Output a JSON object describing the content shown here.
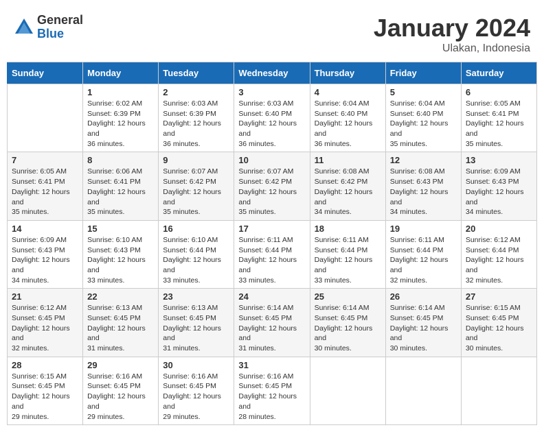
{
  "header": {
    "logo_general": "General",
    "logo_blue": "Blue",
    "month_year": "January 2024",
    "location": "Ulakan, Indonesia"
  },
  "columns": [
    "Sunday",
    "Monday",
    "Tuesday",
    "Wednesday",
    "Thursday",
    "Friday",
    "Saturday"
  ],
  "weeks": [
    [
      {
        "day": "",
        "sunrise": "",
        "sunset": "",
        "daylight": ""
      },
      {
        "day": "1",
        "sunrise": "Sunrise: 6:02 AM",
        "sunset": "Sunset: 6:39 PM",
        "daylight": "Daylight: 12 hours and 36 minutes."
      },
      {
        "day": "2",
        "sunrise": "Sunrise: 6:03 AM",
        "sunset": "Sunset: 6:39 PM",
        "daylight": "Daylight: 12 hours and 36 minutes."
      },
      {
        "day": "3",
        "sunrise": "Sunrise: 6:03 AM",
        "sunset": "Sunset: 6:40 PM",
        "daylight": "Daylight: 12 hours and 36 minutes."
      },
      {
        "day": "4",
        "sunrise": "Sunrise: 6:04 AM",
        "sunset": "Sunset: 6:40 PM",
        "daylight": "Daylight: 12 hours and 36 minutes."
      },
      {
        "day": "5",
        "sunrise": "Sunrise: 6:04 AM",
        "sunset": "Sunset: 6:40 PM",
        "daylight": "Daylight: 12 hours and 35 minutes."
      },
      {
        "day": "6",
        "sunrise": "Sunrise: 6:05 AM",
        "sunset": "Sunset: 6:41 PM",
        "daylight": "Daylight: 12 hours and 35 minutes."
      }
    ],
    [
      {
        "day": "7",
        "sunrise": "Sunrise: 6:05 AM",
        "sunset": "Sunset: 6:41 PM",
        "daylight": "Daylight: 12 hours and 35 minutes."
      },
      {
        "day": "8",
        "sunrise": "Sunrise: 6:06 AM",
        "sunset": "Sunset: 6:41 PM",
        "daylight": "Daylight: 12 hours and 35 minutes."
      },
      {
        "day": "9",
        "sunrise": "Sunrise: 6:07 AM",
        "sunset": "Sunset: 6:42 PM",
        "daylight": "Daylight: 12 hours and 35 minutes."
      },
      {
        "day": "10",
        "sunrise": "Sunrise: 6:07 AM",
        "sunset": "Sunset: 6:42 PM",
        "daylight": "Daylight: 12 hours and 35 minutes."
      },
      {
        "day": "11",
        "sunrise": "Sunrise: 6:08 AM",
        "sunset": "Sunset: 6:42 PM",
        "daylight": "Daylight: 12 hours and 34 minutes."
      },
      {
        "day": "12",
        "sunrise": "Sunrise: 6:08 AM",
        "sunset": "Sunset: 6:43 PM",
        "daylight": "Daylight: 12 hours and 34 minutes."
      },
      {
        "day": "13",
        "sunrise": "Sunrise: 6:09 AM",
        "sunset": "Sunset: 6:43 PM",
        "daylight": "Daylight: 12 hours and 34 minutes."
      }
    ],
    [
      {
        "day": "14",
        "sunrise": "Sunrise: 6:09 AM",
        "sunset": "Sunset: 6:43 PM",
        "daylight": "Daylight: 12 hours and 34 minutes."
      },
      {
        "day": "15",
        "sunrise": "Sunrise: 6:10 AM",
        "sunset": "Sunset: 6:43 PM",
        "daylight": "Daylight: 12 hours and 33 minutes."
      },
      {
        "day": "16",
        "sunrise": "Sunrise: 6:10 AM",
        "sunset": "Sunset: 6:44 PM",
        "daylight": "Daylight: 12 hours and 33 minutes."
      },
      {
        "day": "17",
        "sunrise": "Sunrise: 6:11 AM",
        "sunset": "Sunset: 6:44 PM",
        "daylight": "Daylight: 12 hours and 33 minutes."
      },
      {
        "day": "18",
        "sunrise": "Sunrise: 6:11 AM",
        "sunset": "Sunset: 6:44 PM",
        "daylight": "Daylight: 12 hours and 33 minutes."
      },
      {
        "day": "19",
        "sunrise": "Sunrise: 6:11 AM",
        "sunset": "Sunset: 6:44 PM",
        "daylight": "Daylight: 12 hours and 32 minutes."
      },
      {
        "day": "20",
        "sunrise": "Sunrise: 6:12 AM",
        "sunset": "Sunset: 6:44 PM",
        "daylight": "Daylight: 12 hours and 32 minutes."
      }
    ],
    [
      {
        "day": "21",
        "sunrise": "Sunrise: 6:12 AM",
        "sunset": "Sunset: 6:45 PM",
        "daylight": "Daylight: 12 hours and 32 minutes."
      },
      {
        "day": "22",
        "sunrise": "Sunrise: 6:13 AM",
        "sunset": "Sunset: 6:45 PM",
        "daylight": "Daylight: 12 hours and 31 minutes."
      },
      {
        "day": "23",
        "sunrise": "Sunrise: 6:13 AM",
        "sunset": "Sunset: 6:45 PM",
        "daylight": "Daylight: 12 hours and 31 minutes."
      },
      {
        "day": "24",
        "sunrise": "Sunrise: 6:14 AM",
        "sunset": "Sunset: 6:45 PM",
        "daylight": "Daylight: 12 hours and 31 minutes."
      },
      {
        "day": "25",
        "sunrise": "Sunrise: 6:14 AM",
        "sunset": "Sunset: 6:45 PM",
        "daylight": "Daylight: 12 hours and 30 minutes."
      },
      {
        "day": "26",
        "sunrise": "Sunrise: 6:14 AM",
        "sunset": "Sunset: 6:45 PM",
        "daylight": "Daylight: 12 hours and 30 minutes."
      },
      {
        "day": "27",
        "sunrise": "Sunrise: 6:15 AM",
        "sunset": "Sunset: 6:45 PM",
        "daylight": "Daylight: 12 hours and 30 minutes."
      }
    ],
    [
      {
        "day": "28",
        "sunrise": "Sunrise: 6:15 AM",
        "sunset": "Sunset: 6:45 PM",
        "daylight": "Daylight: 12 hours and 29 minutes."
      },
      {
        "day": "29",
        "sunrise": "Sunrise: 6:16 AM",
        "sunset": "Sunset: 6:45 PM",
        "daylight": "Daylight: 12 hours and 29 minutes."
      },
      {
        "day": "30",
        "sunrise": "Sunrise: 6:16 AM",
        "sunset": "Sunset: 6:45 PM",
        "daylight": "Daylight: 12 hours and 29 minutes."
      },
      {
        "day": "31",
        "sunrise": "Sunrise: 6:16 AM",
        "sunset": "Sunset: 6:45 PM",
        "daylight": "Daylight: 12 hours and 28 minutes."
      },
      {
        "day": "",
        "sunrise": "",
        "sunset": "",
        "daylight": ""
      },
      {
        "day": "",
        "sunrise": "",
        "sunset": "",
        "daylight": ""
      },
      {
        "day": "",
        "sunrise": "",
        "sunset": "",
        "daylight": ""
      }
    ]
  ]
}
